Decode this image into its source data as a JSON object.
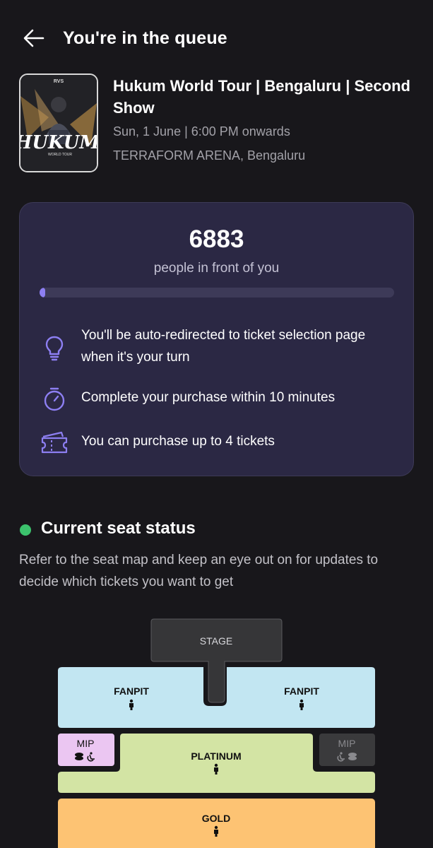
{
  "header": {
    "title": "You're in the queue"
  },
  "event": {
    "poster_text": "HUKUM",
    "poster_subtext": "WORLD TOUR",
    "poster_top_text": "RVS",
    "title": "Hukum World Tour | Bengaluru | Second Show",
    "date": "Sun, 1 June | 6:00 PM onwards",
    "venue": "TERRAFORM ARENA, Bengaluru"
  },
  "queue": {
    "count": "6883",
    "subtitle": "people in front of you",
    "progress_fraction": 0.01,
    "info": [
      {
        "icon": "lightbulb-icon",
        "text": "You'll be auto-redirected to ticket selection page when it's your turn"
      },
      {
        "icon": "stopwatch-icon",
        "text": "Complete your purchase within 10 minutes"
      },
      {
        "icon": "ticket-icon",
        "text": "You can purchase up to 4 tickets"
      }
    ]
  },
  "seat_status": {
    "title": "Current seat status",
    "description": "Refer to the seat map and keep an eye out on for updates to decide which tickets you want to get"
  },
  "seat_map": {
    "stage": "STAGE",
    "fanpit_left": "FANPIT",
    "fanpit_right": "FANPIT",
    "mip_left": "MIP",
    "mip_right": "MIP",
    "platinum": "PLATINUM",
    "gold": "GOLD"
  },
  "colors": {
    "background": "#18171b",
    "card": "#2b2844",
    "accent": "#8d7ff2",
    "status_dot": "#3cc26d",
    "fanpit": "#c2e6f2",
    "mip": "#ebc6f2",
    "mip_unavailable": "#3a3a3c",
    "platinum": "#d3e4a4",
    "gold": "#fdc373",
    "stage": "#363638"
  }
}
